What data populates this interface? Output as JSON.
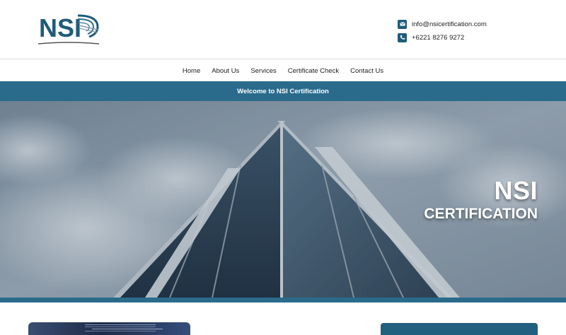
{
  "brand": {
    "logo_text": "NSI",
    "accent_color": "#1f5c7a"
  },
  "contact": {
    "email": "info@nsicertification.com",
    "phone": "+6221 8276 9272",
    "email_icon": "envelope-icon",
    "phone_icon": "phone-icon"
  },
  "nav": {
    "items": [
      {
        "label": "Home"
      },
      {
        "label": "About Us"
      },
      {
        "label": "Services"
      },
      {
        "label": "Certificate Check"
      },
      {
        "label": "Contact Us"
      }
    ]
  },
  "welcome": {
    "text": "Welcome to NSI Certification"
  },
  "hero": {
    "title": "NSI",
    "subtitle": "CERTIFICATION"
  },
  "sidepanel": {
    "title": ""
  }
}
